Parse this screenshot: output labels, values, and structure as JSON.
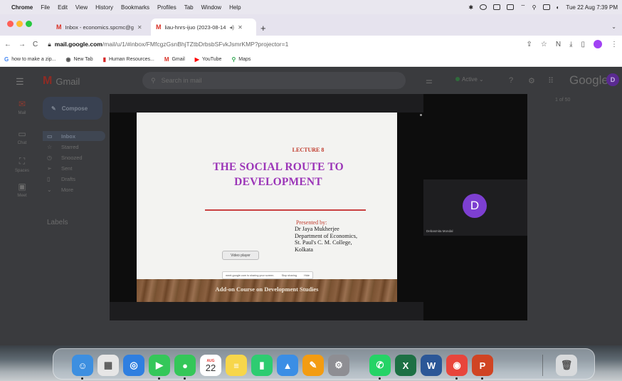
{
  "menubar": {
    "app": "Chrome",
    "items": [
      "File",
      "Edit",
      "View",
      "History",
      "Bookmarks",
      "Profiles",
      "Tab",
      "Window",
      "Help"
    ],
    "clock": "Tue 22 Aug  7:39 PM"
  },
  "tabs": [
    {
      "label": "Inbox - economics.spcmc@g",
      "active": false
    },
    {
      "label": "liau-hnrs-ijuo (2023-08-14",
      "active": true
    }
  ],
  "toolbar": {
    "url_host": "mail.google.com",
    "url_path": "/mail/u/1/#inbox/FMfcgzGsnBhjTZtbDrbsbSFvkJsmrKMP?projector=1"
  },
  "bookmarks": [
    {
      "label": "how to make a zip...",
      "icon": "G"
    },
    {
      "label": "New Tab",
      "icon": "◉"
    },
    {
      "label": "Human Resources...",
      "icon": "▮"
    },
    {
      "label": "Gmail",
      "icon": "M"
    },
    {
      "label": "YouTube",
      "icon": "▶"
    },
    {
      "label": "Maps",
      "icon": "⚲"
    }
  ],
  "gmail": {
    "logo_text": "Gmail",
    "search_placeholder": "Search in mail",
    "status": "Active",
    "brand": "Google",
    "avatar_letter": "D",
    "compose": "Compose",
    "folders": [
      "Inbox",
      "Starred",
      "Snoozed",
      "Sent",
      "Drafts",
      "More"
    ],
    "rail": [
      "Mail",
      "Chat",
      "Spaces",
      "Meet"
    ],
    "labels_heading": "Labels",
    "pager": "1 of 50"
  },
  "slide": {
    "lecture_number": "LECTURE 8",
    "title_line1": "THE SOCIAL ROUTE TO",
    "title_line2": "DEVELOPMENT",
    "presented_by": "Presented by:",
    "presenter_name": "Dr Jaya Mukherjee",
    "presenter_dept": "Department of  Economics,",
    "presenter_college": "St. Paul's C. M. College,",
    "presenter_city": "Kolkata",
    "video_player_label": "Video player",
    "share_left": "meet.google.com is sharing your screen.",
    "share_right": "Stop sharing",
    "share_hide": "Hide",
    "course": "Add-on Course on Development Studies"
  },
  "participant": {
    "avatar_letter": "D",
    "name": "Debasmita Mondal"
  },
  "dock": {
    "calendar_month": "AUG",
    "calendar_day": "22",
    "apps": [
      {
        "name": "finder",
        "color": "#3d8fe0",
        "glyph": "☺"
      },
      {
        "name": "launchpad",
        "color": "#e6e6e6",
        "glyph": "▦"
      },
      {
        "name": "safari",
        "color": "#2f7fe0",
        "glyph": "◎"
      },
      {
        "name": "facetime",
        "color": "#34c759",
        "glyph": "▶"
      },
      {
        "name": "messages",
        "color": "#34c759",
        "glyph": "●"
      },
      {
        "name": "calendar",
        "color": "#ffffff",
        "glyph": ""
      },
      {
        "name": "notes",
        "color": "#f7d64a",
        "glyph": "≡"
      },
      {
        "name": "numbers",
        "color": "#2ecc71",
        "glyph": "▮"
      },
      {
        "name": "keynote",
        "color": "#3b8ee5",
        "glyph": "▲"
      },
      {
        "name": "pages",
        "color": "#f39c12",
        "glyph": "✎"
      },
      {
        "name": "system-settings",
        "color": "#8e8e93",
        "glyph": "⚙"
      },
      {
        "name": "whatsapp",
        "color": "#25d366",
        "glyph": "✆"
      },
      {
        "name": "excel",
        "color": "#1d7044",
        "glyph": "X"
      },
      {
        "name": "word",
        "color": "#2b5797",
        "glyph": "W"
      },
      {
        "name": "chrome",
        "color": "#e8453c",
        "glyph": "◉"
      },
      {
        "name": "powerpoint",
        "color": "#d04423",
        "glyph": "P"
      },
      {
        "name": "trash",
        "color": "#d8dadc",
        "glyph": "🗑"
      }
    ]
  }
}
